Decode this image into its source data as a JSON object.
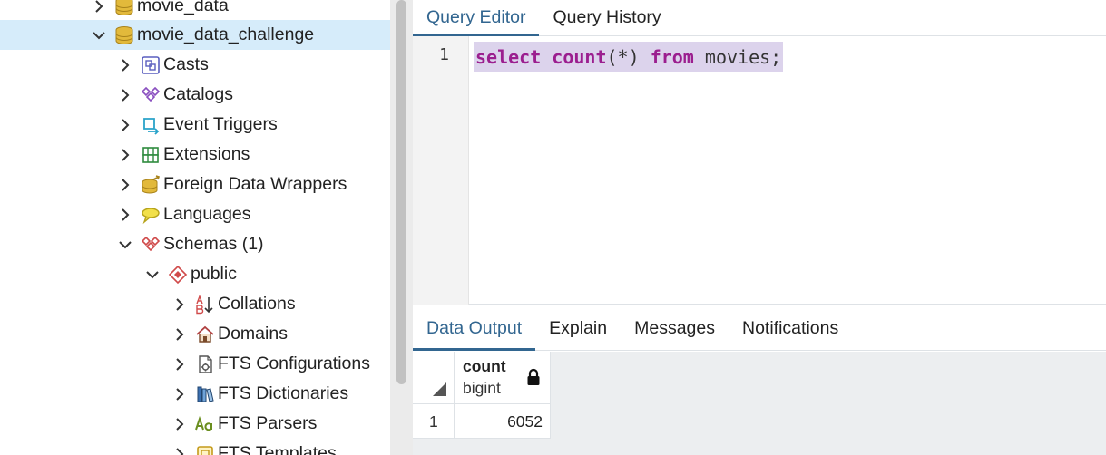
{
  "tree": {
    "items": [
      {
        "label": "movie_data",
        "expanded": false,
        "icon": "database-icon"
      },
      {
        "label": "movie_data_challenge",
        "expanded": true,
        "icon": "database-icon"
      },
      {
        "label": "Casts",
        "expanded": false,
        "icon": "casts-icon"
      },
      {
        "label": "Catalogs",
        "expanded": false,
        "icon": "catalogs-icon"
      },
      {
        "label": "Event Triggers",
        "expanded": false,
        "icon": "event-trigger-icon"
      },
      {
        "label": "Extensions",
        "expanded": false,
        "icon": "extensions-icon"
      },
      {
        "label": "Foreign Data Wrappers",
        "expanded": false,
        "icon": "foreign-data-wrapper-icon"
      },
      {
        "label": "Languages",
        "expanded": false,
        "icon": "languages-icon"
      },
      {
        "label": "Schemas (1)",
        "expanded": true,
        "icon": "schemas-icon"
      },
      {
        "label": "public",
        "expanded": true,
        "icon": "schema-icon"
      },
      {
        "label": "Collations",
        "expanded": false,
        "icon": "collations-icon"
      },
      {
        "label": "Domains",
        "expanded": false,
        "icon": "domains-icon"
      },
      {
        "label": "FTS Configurations",
        "expanded": false,
        "icon": "fts-configuration-icon"
      },
      {
        "label": "FTS Dictionaries",
        "expanded": false,
        "icon": "fts-dictionary-icon"
      },
      {
        "label": "FTS Parsers",
        "expanded": false,
        "icon": "fts-parser-icon"
      },
      {
        "label": "FTS Templates",
        "expanded": false,
        "icon": "fts-template-icon"
      }
    ]
  },
  "editor_tabs": [
    "Query Editor",
    "Query History"
  ],
  "editor": {
    "line_number": "1",
    "tokens": {
      "select": "select",
      "count": "count",
      "star": "(*)",
      "from": "from",
      "rest": "movies;"
    }
  },
  "result_tabs": [
    "Data Output",
    "Explain",
    "Messages",
    "Notifications"
  ],
  "grid": {
    "columns": [
      {
        "name": "count",
        "type": "bigint"
      }
    ],
    "rows": [
      {
        "row_number": "1",
        "values": [
          "6052"
        ]
      }
    ]
  },
  "colors": {
    "accent": "#326690",
    "selected_row": "#d6ecfa",
    "keyword": "#9b1e8f",
    "highlight": "#dcd3ec"
  }
}
